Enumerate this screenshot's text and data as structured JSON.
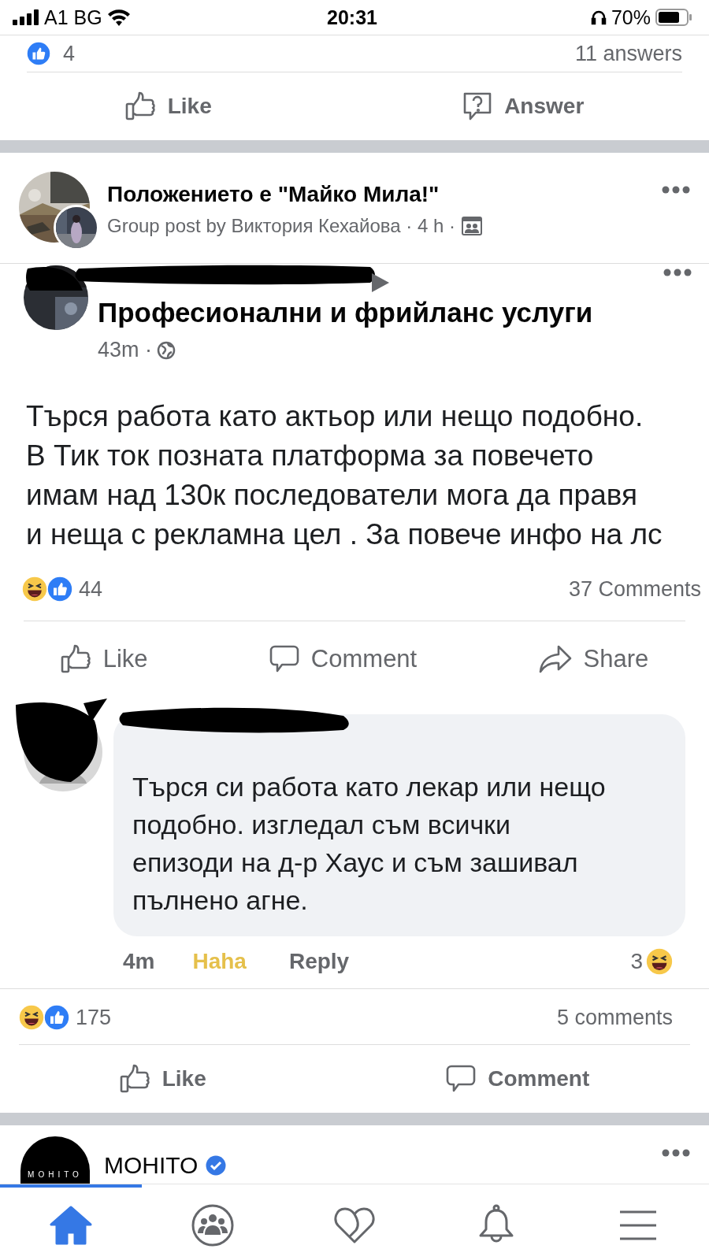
{
  "status_bar": {
    "carrier": "A1 BG",
    "time": "20:31",
    "battery": "70%"
  },
  "previous_post": {
    "reaction_count": "4",
    "answers": "11 answers",
    "actions": [
      {
        "kind": "like",
        "label": "Like"
      },
      {
        "kind": "answer",
        "label": "Answer"
      }
    ]
  },
  "post": {
    "group_name": "Положението е \"Майко Мила!\"",
    "byline": "Group post by Виктория Кехайова · 4 h ·",
    "shared_screenshot": {
      "category": "Професионални и фрийланс услуги",
      "time": "43m ·",
      "text": "Търся работа като актьор или нещо подобно.\nВ Тик ток позната платформа за повечето\nимам над 130к последователи мога да правя\nи неща с рекламна цел . За повече инфо на лс",
      "reaction_count": "44",
      "comments": "37 Comments",
      "actions": [
        {
          "kind": "like",
          "label": "Like"
        },
        {
          "kind": "comment",
          "label": "Comment"
        },
        {
          "kind": "share",
          "label": "Share"
        }
      ],
      "comment": {
        "text": "Търся си работа като лекар или нещо\nподобно. изгледал съм всички\nепизоди на д-р Хаус и съм зашивал\nпълнено агне.",
        "time": "4m",
        "reaction": "Haha",
        "reply": "Reply",
        "reaction_count": "3"
      }
    },
    "reaction_count": "175",
    "comments": "5 comments",
    "actions": [
      {
        "kind": "like",
        "label": "Like"
      },
      {
        "kind": "comment",
        "label": "Comment"
      }
    ]
  },
  "next_post": {
    "name": "MOHITO",
    "logo_text": "MOHITO",
    "verified": true
  },
  "nav": [
    {
      "kind": "home",
      "selected": true
    },
    {
      "kind": "groups",
      "selected": false
    },
    {
      "kind": "dating",
      "selected": false
    },
    {
      "kind": "notifications",
      "selected": false
    },
    {
      "kind": "menu",
      "selected": false
    }
  ]
}
